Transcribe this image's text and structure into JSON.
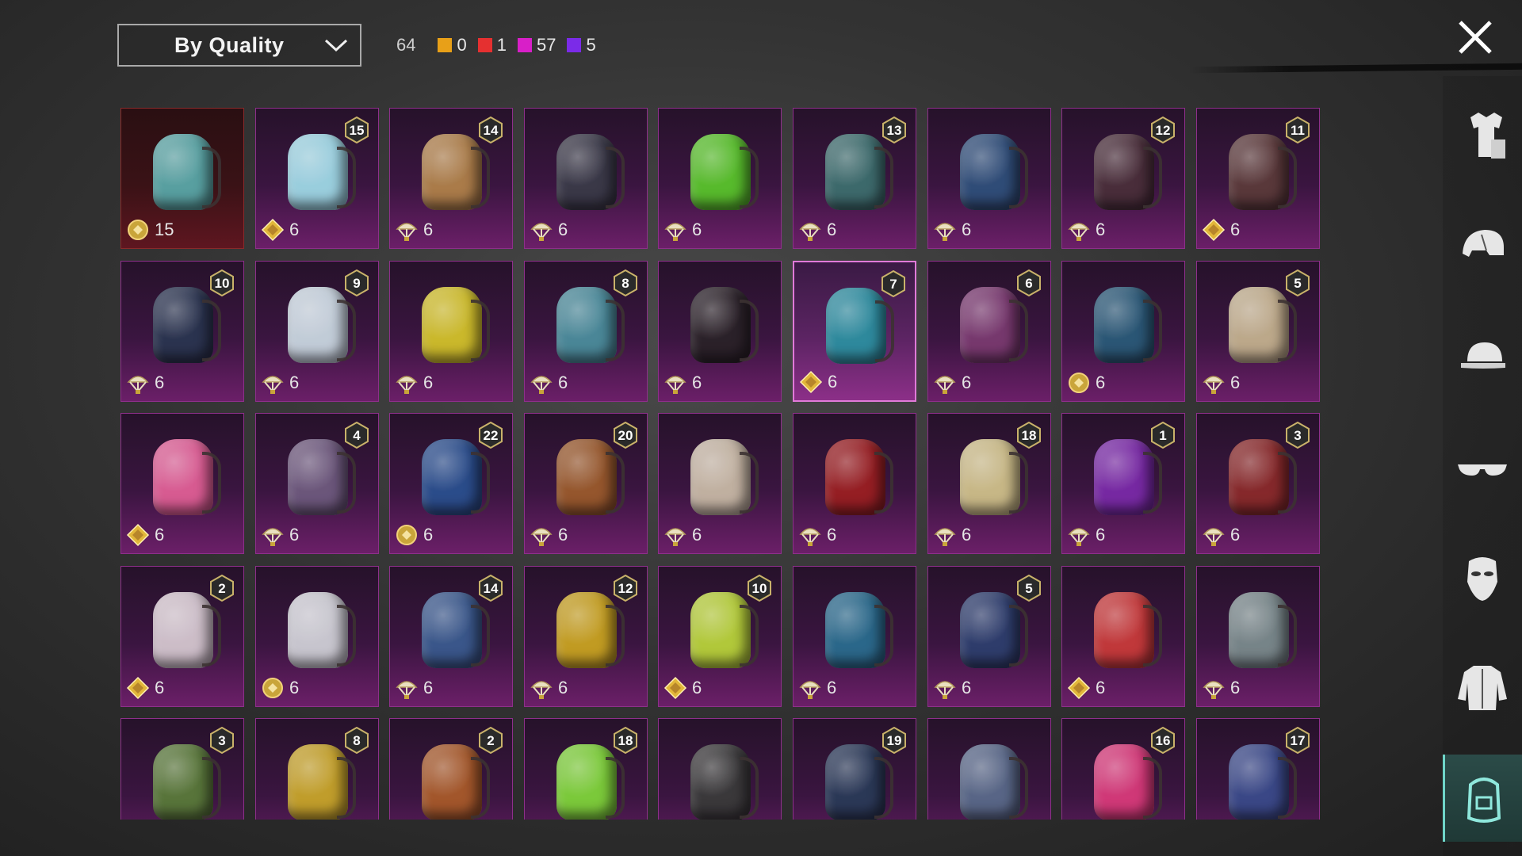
{
  "sort": {
    "label": "By Quality"
  },
  "counts": {
    "total": "64",
    "qualities": [
      {
        "color": "#e8a018",
        "value": "0"
      },
      {
        "color": "#e53030",
        "value": "1"
      },
      {
        "color": "#d81fc8",
        "value": "57"
      },
      {
        "color": "#7b2be8",
        "value": "5"
      }
    ]
  },
  "sidebar": [
    {
      "name": "outfit-category",
      "icon": "outfit-icon"
    },
    {
      "name": "helmet-category",
      "icon": "helmet-icon"
    },
    {
      "name": "hat-category",
      "icon": "cap-icon"
    },
    {
      "name": "glasses-category",
      "icon": "glasses-icon"
    },
    {
      "name": "mask-category",
      "icon": "mask-icon"
    },
    {
      "name": "jacket-category",
      "icon": "jacket-icon"
    },
    {
      "name": "backpack-category",
      "icon": "backpack-icon",
      "active": true
    }
  ],
  "items": [
    {
      "level": "",
      "currency": "gold-coin",
      "count": "15",
      "tone": "red",
      "color": "#5aa7a8"
    },
    {
      "level": "15",
      "currency": "gold-diamond",
      "count": "6",
      "color": "#9fd8e6"
    },
    {
      "level": "14",
      "currency": "parachute",
      "count": "6",
      "color": "#b0814a"
    },
    {
      "level": "",
      "currency": "parachute",
      "count": "6",
      "color": "#3a3a48"
    },
    {
      "level": "",
      "currency": "parachute",
      "count": "6",
      "color": "#59c32b"
    },
    {
      "level": "13",
      "currency": "parachute",
      "count": "6",
      "color": "#3d6e6e"
    },
    {
      "level": "",
      "currency": "parachute",
      "count": "6",
      "color": "#2f4f7a"
    },
    {
      "level": "12",
      "currency": "parachute",
      "count": "6",
      "color": "#4a2f3a"
    },
    {
      "level": "11",
      "currency": "gold-diamond",
      "count": "6",
      "color": "#5b3a3a"
    },
    {
      "level": "10",
      "currency": "parachute",
      "count": "6",
      "color": "#2a3550"
    },
    {
      "level": "9",
      "currency": "parachute",
      "count": "6",
      "color": "#c9d6e0"
    },
    {
      "level": "",
      "currency": "parachute",
      "count": "6",
      "color": "#d2c12a"
    },
    {
      "level": "8",
      "currency": "parachute",
      "count": "6",
      "color": "#4b8d9c"
    },
    {
      "level": "",
      "currency": "parachute",
      "count": "6",
      "color": "#2a2228"
    },
    {
      "level": "7",
      "currency": "gold-diamond",
      "count": "6",
      "color": "#2c8fa0",
      "selected": true
    },
    {
      "level": "6",
      "currency": "parachute",
      "count": "6",
      "color": "#7a3a70"
    },
    {
      "level": "",
      "currency": "gold-coin",
      "count": "6",
      "color": "#2a5a78"
    },
    {
      "level": "5",
      "currency": "parachute",
      "count": "6",
      "color": "#c3b08e"
    },
    {
      "level": "",
      "currency": "gold-diamond",
      "count": "6",
      "color": "#e05f96"
    },
    {
      "level": "4",
      "currency": "parachute",
      "count": "6",
      "color": "#6e5a7e"
    },
    {
      "level": "22",
      "currency": "gold-coin",
      "count": "6",
      "color": "#2a4f8e"
    },
    {
      "level": "20",
      "currency": "parachute",
      "count": "6",
      "color": "#9a5a2c"
    },
    {
      "level": "",
      "currency": "parachute",
      "count": "6",
      "color": "#c8b9a6"
    },
    {
      "level": "",
      "currency": "parachute",
      "count": "6",
      "color": "#9a1f22"
    },
    {
      "level": "18",
      "currency": "parachute",
      "count": "6",
      "color": "#cfc08a"
    },
    {
      "level": "1",
      "currency": "parachute",
      "count": "6",
      "color": "#7a2aa8"
    },
    {
      "level": "3",
      "currency": "parachute",
      "count": "6",
      "color": "#8a2a2a"
    },
    {
      "level": "2",
      "currency": "gold-diamond",
      "count": "6",
      "color": "#d4c6cf"
    },
    {
      "level": "",
      "currency": "gold-coin",
      "count": "6",
      "color": "#cfcfd6"
    },
    {
      "level": "14",
      "currency": "parachute",
      "count": "6",
      "color": "#3a5a8e"
    },
    {
      "level": "12",
      "currency": "parachute",
      "count": "6",
      "color": "#c9a321"
    },
    {
      "level": "10",
      "currency": "gold-diamond",
      "count": "6",
      "color": "#b8d23a"
    },
    {
      "level": "",
      "currency": "parachute",
      "count": "6",
      "color": "#2a6c8e"
    },
    {
      "level": "5",
      "currency": "parachute",
      "count": "6",
      "color": "#2e3f6e"
    },
    {
      "level": "",
      "currency": "gold-diamond",
      "count": "6",
      "color": "#c83a3a"
    },
    {
      "level": "",
      "currency": "parachute",
      "count": "6",
      "color": "#7a8a8c"
    },
    {
      "level": "3",
      "currency": "",
      "count": "",
      "color": "#5a7a3a"
    },
    {
      "level": "8",
      "currency": "",
      "count": "",
      "color": "#c8a52a"
    },
    {
      "level": "2",
      "currency": "",
      "count": "",
      "color": "#a85a2a"
    },
    {
      "level": "18",
      "currency": "",
      "count": "",
      "color": "#7fd33a"
    },
    {
      "level": "",
      "currency": "",
      "count": "",
      "color": "#3a3a3a"
    },
    {
      "level": "19",
      "currency": "",
      "count": "",
      "color": "#2a3a58"
    },
    {
      "level": "",
      "currency": "",
      "count": "",
      "color": "#5a6a8a"
    },
    {
      "level": "16",
      "currency": "",
      "count": "",
      "color": "#d83a7a"
    },
    {
      "level": "17",
      "currency": "",
      "count": "",
      "color": "#3a4a8a"
    }
  ]
}
